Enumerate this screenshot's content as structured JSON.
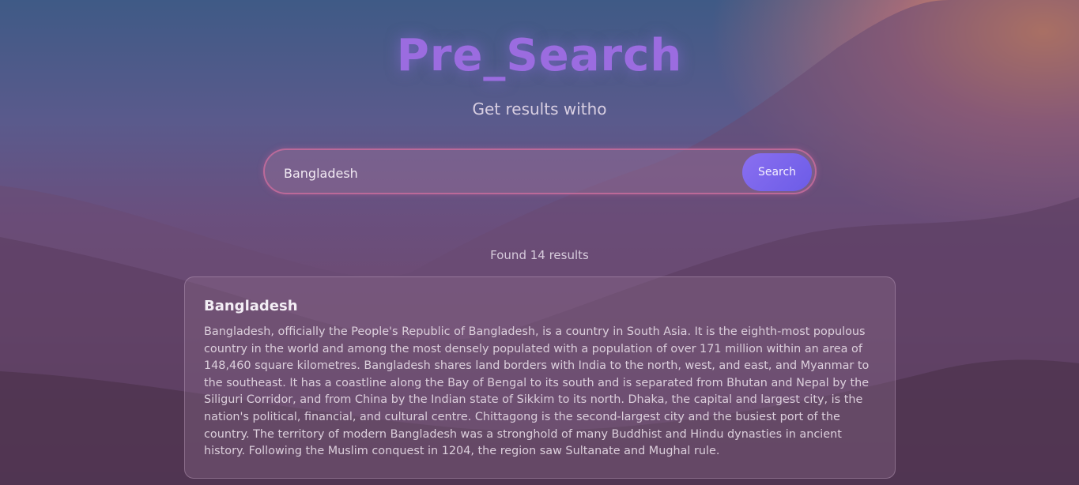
{
  "header": {
    "title": "Pre_Search",
    "subtitle": "Get results witho"
  },
  "search": {
    "value": "Bangladesh",
    "button_label": "Search"
  },
  "results": {
    "summary": "Found 14 results",
    "items": [
      {
        "title": "Bangladesh",
        "snippet": "Bangladesh, officially the People's Republic of Bangladesh, is a country in South Asia. It is the eighth-most populous country in the world and among the most densely populated with a population of over 171 million within an area of 148,460 square kilometres. Bangladesh shares land borders with India to the north, west, and east, and Myanmar to the southeast. It has a coastline along the Bay of Bengal to its south and is separated from Bhutan and Nepal by the Siliguri Corridor, and from China by the Indian state of Sikkim to its north. Dhaka, the capital and largest city, is the nation's political, financial, and cultural centre. Chittagong is the second-largest city and the busiest port of the country. The territory of modern Bangladesh was a stronghold of many Buddhist and Hindu dynasties in ancient history. Following the Muslim conquest in 1204, the region saw Sultanate and Mughal rule."
      }
    ]
  },
  "colors": {
    "accent": "#9b6ce0",
    "button": "#7b68ee",
    "sunset": "#ffa050"
  }
}
